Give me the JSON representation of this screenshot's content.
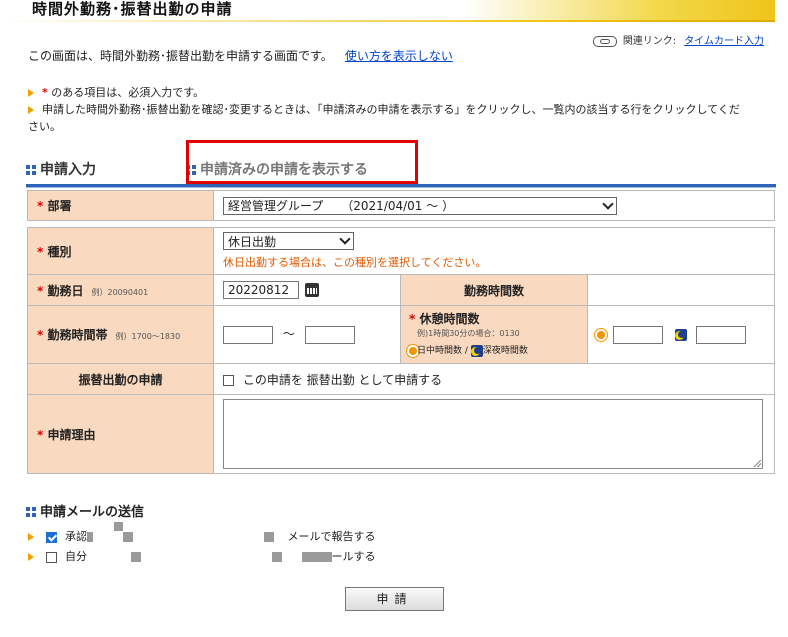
{
  "page": {
    "title": "時間外勤務･振替出勤の申請",
    "related_label": "関連リンク:",
    "related_link": "タイムカード入力",
    "intro_text": "この画面は、時間外勤務･振替出勤を申請する画面です。",
    "intro_link": "使い方を表示しない",
    "note1_suffix": "のある項目は、必須入力です。",
    "note2": "申請した時間外勤務･振替出勤を確認･変更するときは、「申請済みの申請を表示する」をクリックし、一覧内の該当する行をクリックしてください。"
  },
  "tabs": {
    "input": "申請入力",
    "submitted": "申請済みの申請を表示する"
  },
  "form": {
    "dept_label": "部署",
    "dept_value": "経営管理グループ　　（2021/04/01 ～ ）",
    "type_label": "種別",
    "type_value": "休日出勤",
    "type_hint": "休日出勤する場合は、この種別を選択してください。",
    "workday_label": "勤務日",
    "workday_example": "例）20090401",
    "workday_value": "20220812",
    "hours_label": "勤務時間数",
    "timeband_label": "勤務時間帯",
    "timeband_example": "例）1700～1830",
    "timeband_sep": "～",
    "break_label": "休憩時間数",
    "break_example": "例)1時間30分の場合：0130",
    "break_day": "日中時間数",
    "break_sep": "/",
    "break_night": "深夜時間数",
    "transfer_label": "振替出勤の申請",
    "transfer_text": "この申請を 振替出勤 として申請する",
    "reason_label": "申請理由",
    "required_mark": "*"
  },
  "mail": {
    "title": "申請メールの送信",
    "row1_label": "承認",
    "row1_suffix": "メールで報告する",
    "row2_label": "自分",
    "row2_suffix": "ールする"
  },
  "submit_label": "申請",
  "colors": {
    "accent_blue": "#2e63b8",
    "label_bg": "#f9d9bf",
    "required_red": "#e00000",
    "hint_orange": "#e05a00",
    "highlight_red": "#e00000"
  }
}
